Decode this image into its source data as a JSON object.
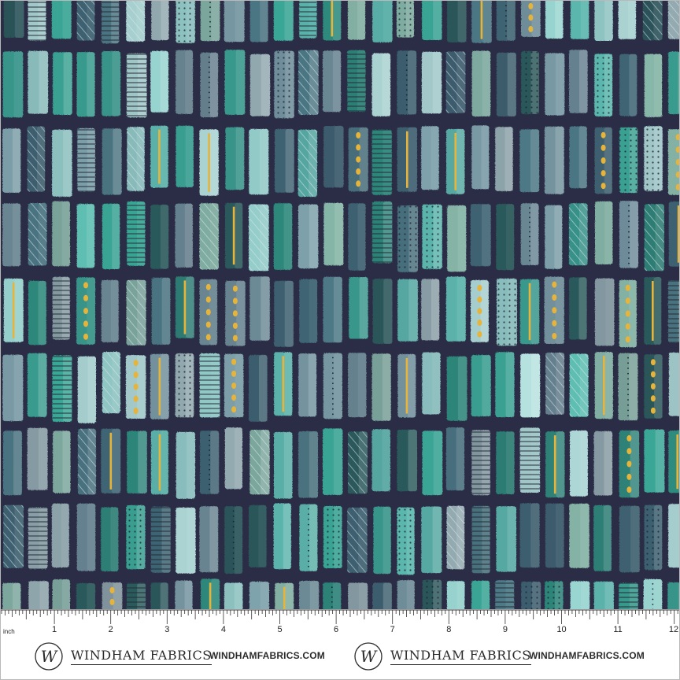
{
  "image": {
    "subject": "fabric-swatch",
    "background_color": "#2a2d45",
    "palette": [
      "#3aa897",
      "#2f8c7e",
      "#5fc0b4",
      "#9ad6d1",
      "#b7e4e1",
      "#6f8f9b",
      "#7fa3ad",
      "#4e7a86",
      "#3f6674",
      "#93aab0",
      "#2c5a5c",
      "#87b7a8"
    ],
    "accent_color": "#e6b43a",
    "pattern_motif": "watercolor-stripes"
  },
  "ruler": {
    "unit_label": "inch",
    "numbers": [
      "1",
      "2",
      "3",
      "4",
      "5",
      "6",
      "7",
      "8",
      "9",
      "10",
      "11",
      "12"
    ]
  },
  "branding": [
    {
      "logo_letter": "W",
      "name": "WINDHAM FABRICS",
      "url": "WINDHAMFABRICS.COM"
    },
    {
      "logo_letter": "W",
      "name": "WINDHAM FABRICS",
      "url": "WINDHAMFABRICS.COM"
    }
  ]
}
